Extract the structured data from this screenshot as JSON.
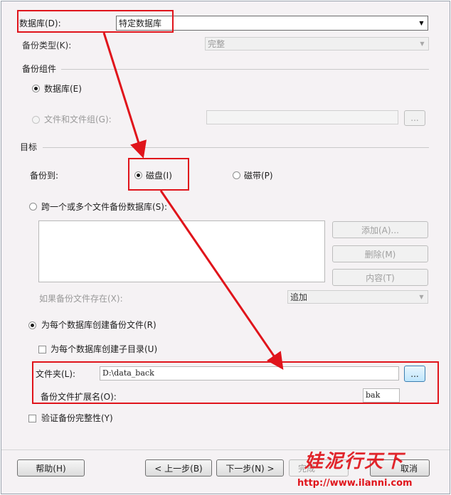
{
  "database": {
    "label": "数据库(D):",
    "value": "特定数据库"
  },
  "backup_type": {
    "label": "备份类型(K):",
    "value": "完整"
  },
  "backup_component": {
    "heading": "备份组件",
    "database_option": "数据库(E)",
    "files_option": "文件和文件组(G):",
    "browse_label": "..."
  },
  "target": {
    "heading": "目标",
    "backup_to_label": "备份到:",
    "disk_option": "磁盘(I)",
    "tape_option": "磁带(P)"
  },
  "span": {
    "option": "跨一个或多个文件备份数据库(S):",
    "add_button": "添加(A)...",
    "remove_button": "删除(M)",
    "contents_button": "内容(T)",
    "exists_label": "如果备份文件存在(X):",
    "exists_value": "追加"
  },
  "per_db": {
    "option": "为每个数据库创建备份文件(R)",
    "subdir_option": "为每个数据库创建子目录(U)",
    "folder_label": "文件夹(L):",
    "folder_value": "D:\\data_back",
    "folder_browse": "...",
    "ext_label": "备份文件扩展名(O):",
    "ext_value": "bak"
  },
  "verify": {
    "label": "验证备份完整性(Y)"
  },
  "footer": {
    "help": "帮助(H)",
    "back": "< 上一步(B)",
    "next": "下一步(N) >",
    "finish": "完成",
    "cancel": "取消"
  },
  "watermark": {
    "text": "娃泥行天下",
    "url": "http://www.ilanni.com"
  },
  "colors": {
    "annotation": "#e0141b",
    "dialog_bg": "#f5f2f4"
  }
}
